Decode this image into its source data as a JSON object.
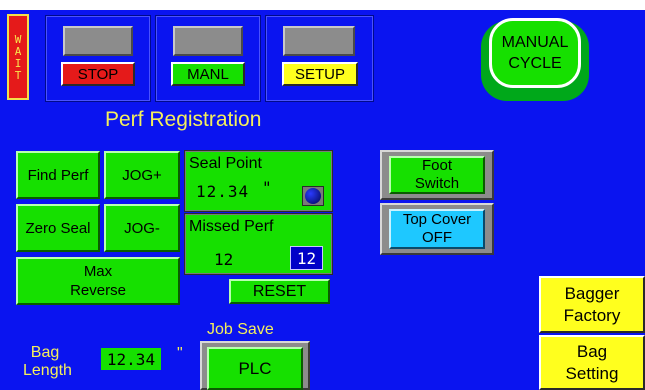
{
  "status": {
    "wait_label": "WAIT"
  },
  "top_buttons": {
    "stop": "STOP",
    "manl": "MANL",
    "setup": "SETUP"
  },
  "manual_cycle": {
    "label_line1": "MANUAL",
    "label_line2": "CYCLE"
  },
  "section_title": "Perf Registration",
  "perf": {
    "find_perf": "Find Perf",
    "jog_plus": "JOG+",
    "zero_seal": "Zero Seal",
    "jog_minus": "JOG-",
    "max_reverse_line1": "Max",
    "max_reverse_line2": "Reverse"
  },
  "seal_point": {
    "label": "Seal Point",
    "value": "12.34",
    "unit": "\""
  },
  "missed_perf": {
    "label": "Missed Perf",
    "value": "12",
    "setting": "12"
  },
  "reset": "RESET",
  "foot_switch": {
    "line1": "Foot",
    "line2": "Switch"
  },
  "top_cover": {
    "line1": "Top Cover",
    "line2": "OFF"
  },
  "bag_length": {
    "label_line1": "Bag",
    "label_line2": "Length",
    "value": "12.34",
    "unit": "\""
  },
  "job_save": {
    "label": "Job Save",
    "button": "PLC"
  },
  "right_panel": {
    "bagger_factory_line1": "Bagger",
    "bagger_factory_line2": "Factory",
    "bag_setting_line1": "Bag",
    "bag_setting_line2": "Setting"
  },
  "colors": {
    "background": "#0a14f0",
    "button_green": "#16e000",
    "stop_red": "#e51a1a",
    "setup_yellow": "#ffff1e",
    "top_cover_cyan": "#1ec8ff"
  }
}
